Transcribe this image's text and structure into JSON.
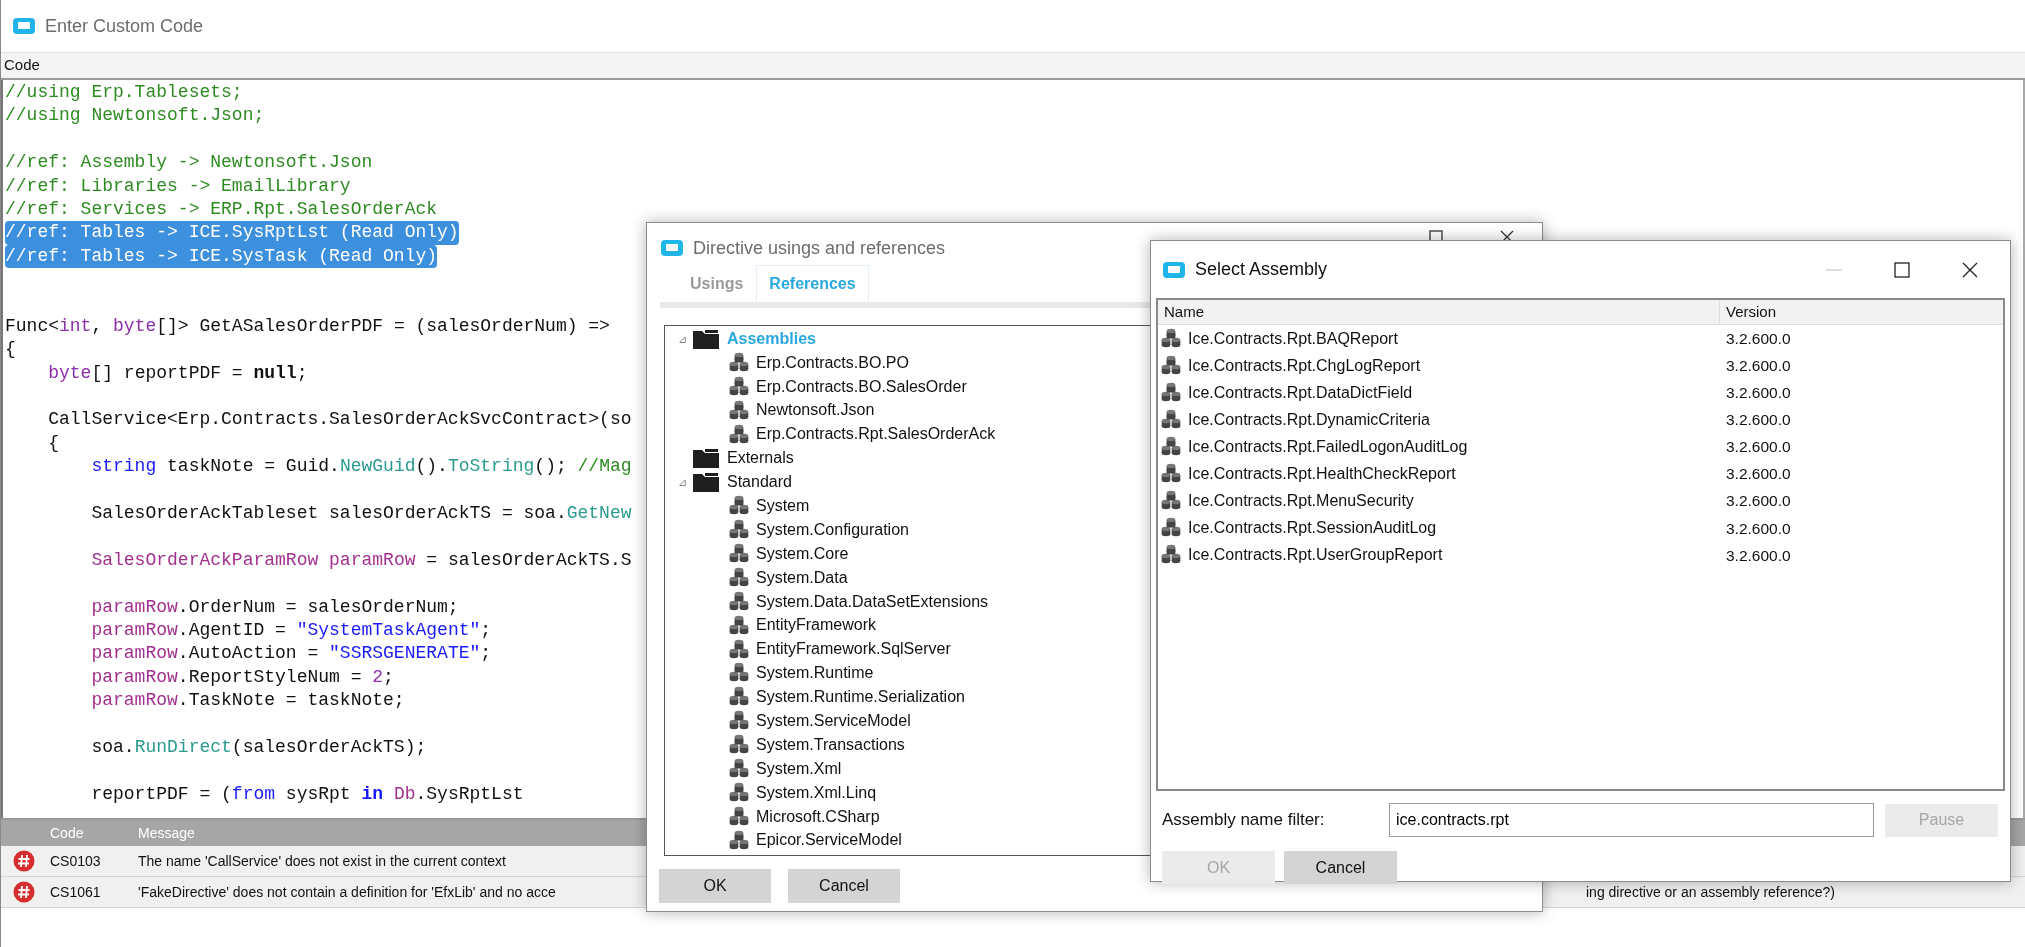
{
  "main_window": {
    "title": "Enter Custom Code",
    "section_label": "Code"
  },
  "code_editor": {
    "lines": [
      {
        "kind": "code",
        "selected": false,
        "tokens": [
          {
            "kind": "comment",
            "text": "//using Erp.Tablesets;"
          }
        ]
      },
      {
        "kind": "code",
        "selected": false,
        "tokens": [
          {
            "kind": "comment",
            "text": "//using Newtonsoft.Json;"
          }
        ]
      },
      {
        "kind": "blank"
      },
      {
        "kind": "code",
        "selected": false,
        "tokens": [
          {
            "kind": "comment",
            "text": "//ref: Assembly -> Newtonsoft.Json"
          }
        ]
      },
      {
        "kind": "code",
        "selected": false,
        "tokens": [
          {
            "kind": "comment",
            "text": "//ref: Libraries -> EmailLibrary"
          }
        ]
      },
      {
        "kind": "code",
        "selected": false,
        "tokens": [
          {
            "kind": "comment",
            "text": "//ref: Services -> ERP.Rpt.SalesOrderAck"
          }
        ]
      },
      {
        "kind": "code",
        "selected": true,
        "tokens": [
          {
            "kind": "comment",
            "text": "//ref: Tables -> ICE.SysRptLst (Read Only)"
          }
        ]
      },
      {
        "kind": "code",
        "selected": true,
        "tokens": [
          {
            "kind": "comment",
            "text": "//ref: Tables -> ICE.SysTask (Read Only)"
          }
        ]
      },
      {
        "kind": "blank"
      },
      {
        "kind": "blank"
      },
      {
        "kind": "code",
        "selected": false,
        "tokens": [
          {
            "kind": "plain",
            "text": "Func<"
          },
          {
            "kind": "type",
            "text": "int"
          },
          {
            "kind": "plain",
            "text": ", "
          },
          {
            "kind": "type",
            "text": "byte"
          },
          {
            "kind": "plain",
            "text": "[]> GetASalesOrderPDF = (salesOrderNum) =>"
          }
        ]
      },
      {
        "kind": "code",
        "selected": false,
        "tokens": [
          {
            "kind": "plain",
            "text": "{"
          }
        ]
      },
      {
        "kind": "code",
        "selected": false,
        "tokens": [
          {
            "kind": "type",
            "text": "    byte"
          },
          {
            "kind": "plain",
            "text": "[] reportPDF = "
          },
          {
            "kind": "bold",
            "text": "null"
          },
          {
            "kind": "plain",
            "text": ";"
          }
        ]
      },
      {
        "kind": "blank"
      },
      {
        "kind": "code",
        "selected": false,
        "tokens": [
          {
            "kind": "plain",
            "text": "    CallService<Erp.Contracts.SalesOrderAckSvcContract>(so"
          }
        ]
      },
      {
        "kind": "code",
        "selected": false,
        "tokens": [
          {
            "kind": "plain",
            "text": "    {"
          }
        ]
      },
      {
        "kind": "code",
        "selected": false,
        "tokens": [
          {
            "kind": "keyword",
            "text": "        string"
          },
          {
            "kind": "plain",
            "text": " taskNote = Guid."
          },
          {
            "kind": "method",
            "text": "NewGuid"
          },
          {
            "kind": "plain",
            "text": "()."
          },
          {
            "kind": "method",
            "text": "ToString"
          },
          {
            "kind": "plain",
            "text": "(); "
          },
          {
            "kind": "comment",
            "text": "//Mag"
          }
        ]
      },
      {
        "kind": "blank"
      },
      {
        "kind": "code",
        "selected": false,
        "tokens": [
          {
            "kind": "plain",
            "text": "        SalesOrderAckTableset salesOrderAckTS = soa."
          },
          {
            "kind": "method",
            "text": "GetNew"
          }
        ]
      },
      {
        "kind": "blank"
      },
      {
        "kind": "code",
        "selected": false,
        "tokens": [
          {
            "kind": "variable",
            "text": "        SalesOrderAckParamRow"
          },
          {
            "kind": "variable",
            "text": " paramRow"
          },
          {
            "kind": "plain",
            "text": " = salesOrderAckTS.S"
          }
        ]
      },
      {
        "kind": "blank"
      },
      {
        "kind": "code",
        "selected": false,
        "tokens": [
          {
            "kind": "variable",
            "text": "        paramRow"
          },
          {
            "kind": "plain",
            "text": ".OrderNum = salesOrderNum;"
          }
        ]
      },
      {
        "kind": "code",
        "selected": false,
        "tokens": [
          {
            "kind": "variable",
            "text": "        paramRow"
          },
          {
            "kind": "plain",
            "text": ".AgentID = "
          },
          {
            "kind": "string",
            "text": "\"SystemTaskAgent\""
          },
          {
            "kind": "plain",
            "text": ";"
          }
        ]
      },
      {
        "kind": "code",
        "selected": false,
        "tokens": [
          {
            "kind": "variable",
            "text": "        paramRow"
          },
          {
            "kind": "plain",
            "text": ".AutoAction = "
          },
          {
            "kind": "string",
            "text": "\"SSRSGENERATE\""
          },
          {
            "kind": "plain",
            "text": ";"
          }
        ]
      },
      {
        "kind": "code",
        "selected": false,
        "tokens": [
          {
            "kind": "variable",
            "text": "        paramRow"
          },
          {
            "kind": "plain",
            "text": ".ReportStyleNum = "
          },
          {
            "kind": "number",
            "text": "2"
          },
          {
            "kind": "plain",
            "text": ";"
          }
        ]
      },
      {
        "kind": "code",
        "selected": false,
        "tokens": [
          {
            "kind": "variable",
            "text": "        paramRow"
          },
          {
            "kind": "plain",
            "text": ".TaskNote = taskNote;"
          }
        ]
      },
      {
        "kind": "blank"
      },
      {
        "kind": "code",
        "selected": false,
        "tokens": [
          {
            "kind": "plain",
            "text": "        soa."
          },
          {
            "kind": "method",
            "text": "RunDirect"
          },
          {
            "kind": "plain",
            "text": "(salesOrderAckTS);"
          }
        ]
      },
      {
        "kind": "blank"
      },
      {
        "kind": "code",
        "selected": false,
        "tokens": [
          {
            "kind": "plain",
            "text": "        reportPDF = ("
          },
          {
            "kind": "keyword",
            "text": "from"
          },
          {
            "kind": "plain",
            "text": " sysRpt "
          },
          {
            "kind": "keyword_bold",
            "text": "in"
          },
          {
            "kind": "variable",
            "text": " Db"
          },
          {
            "kind": "plain",
            "text": ".SysRptLst"
          }
        ]
      }
    ]
  },
  "errors": {
    "columns": [
      "Code",
      "Message"
    ],
    "rows": [
      {
        "code": "CS0103",
        "message": "The name 'CallService' does not exist in the current context"
      },
      {
        "code": "CS1061",
        "message": "'FakeDirective' does not contain a definition for 'EfxLib' and no acce",
        "message_tail": "ing directive or an assembly reference?)"
      }
    ]
  },
  "directive_dialog": {
    "title": "Directive usings and references",
    "tabs": [
      {
        "label": "Usings",
        "selected": false
      },
      {
        "label": "References",
        "selected": true
      }
    ],
    "tree": [
      {
        "label": "Assemblies",
        "toggle": "⊿",
        "selected": true,
        "children": [
          {
            "label": "Erp.Contracts.BO.PO",
            "selected": false
          },
          {
            "label": "Erp.Contracts.BO.SalesOrder",
            "selected": false
          },
          {
            "label": "Newtonsoft.Json",
            "selected": false
          },
          {
            "label": "Erp.Contracts.Rpt.SalesOrderAck",
            "selected": false
          }
        ]
      },
      {
        "label": "Externals",
        "selected": false
      },
      {
        "label": "Standard",
        "toggle": "⊿",
        "selected": false,
        "children": [
          {
            "label": "System",
            "selected": false
          },
          {
            "label": "System.Configuration",
            "selected": false
          },
          {
            "label": "System.Core",
            "selected": false
          },
          {
            "label": "System.Data",
            "selected": false
          },
          {
            "label": "System.Data.DataSetExtensions",
            "selected": false
          },
          {
            "label": "EntityFramework",
            "selected": false
          },
          {
            "label": "EntityFramework.SqlServer",
            "selected": false
          },
          {
            "label": "System.Runtime",
            "selected": false
          },
          {
            "label": "System.Runtime.Serialization",
            "selected": false
          },
          {
            "label": "System.ServiceModel",
            "selected": false
          },
          {
            "label": "System.Transactions",
            "selected": false
          },
          {
            "label": "System.Xml",
            "selected": false
          },
          {
            "label": "System.Xml.Linq",
            "selected": false
          },
          {
            "label": "Microsoft.CSharp",
            "selected": false
          },
          {
            "label": "Epicor.ServiceModel",
            "selected": false
          }
        ]
      }
    ],
    "buttons": [
      "OK",
      "Cancel"
    ]
  },
  "select_assembly_dialog": {
    "title": "Select Assembly",
    "columns": [
      "Name",
      "Version"
    ],
    "rows": [
      {
        "name": "Ice.Contracts.Rpt.BAQReport",
        "version": "3.2.600.0"
      },
      {
        "name": "Ice.Contracts.Rpt.ChgLogReport",
        "version": "3.2.600.0"
      },
      {
        "name": "Ice.Contracts.Rpt.DataDictField",
        "version": "3.2.600.0"
      },
      {
        "name": "Ice.Contracts.Rpt.DynamicCriteria",
        "version": "3.2.600.0"
      },
      {
        "name": "Ice.Contracts.Rpt.FailedLogonAuditLog",
        "version": "3.2.600.0"
      },
      {
        "name": "Ice.Contracts.Rpt.HealthCheckReport",
        "version": "3.2.600.0"
      },
      {
        "name": "Ice.Contracts.Rpt.MenuSecurity",
        "version": "3.2.600.0"
      },
      {
        "name": "Ice.Contracts.Rpt.SessionAuditLog",
        "version": "3.2.600.0"
      },
      {
        "name": "Ice.Contracts.Rpt.UserGroupReport",
        "version": "3.2.600.0"
      }
    ],
    "filter": {
      "label": "Assembly name filter:",
      "value": "ice.contracts.rpt"
    },
    "pause_button": {
      "label": "Pause",
      "disabled": true
    },
    "buttons": [
      {
        "label": "OK",
        "disabled": true
      },
      {
        "label": "Cancel",
        "disabled": false
      }
    ]
  }
}
